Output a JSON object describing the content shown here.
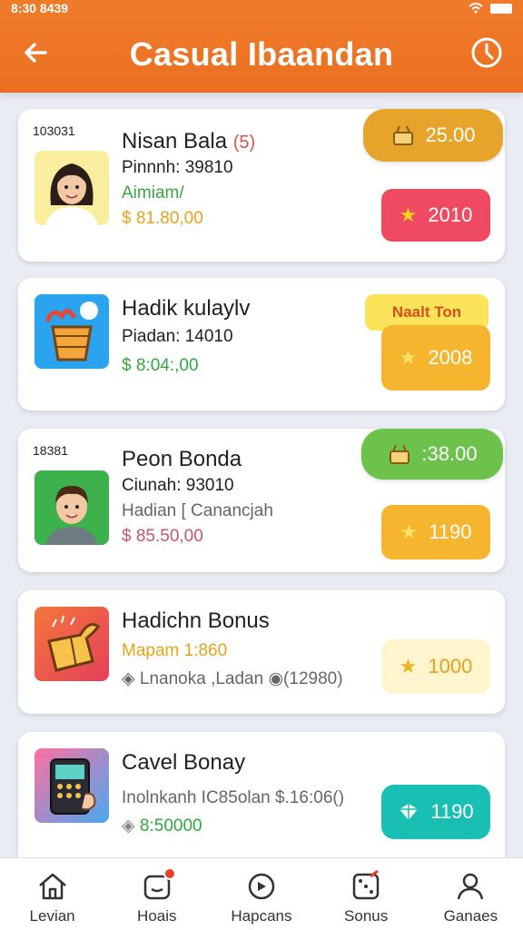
{
  "statusbar": {
    "time": "8:30  8439"
  },
  "header": {
    "title": "Casual Ibaandan"
  },
  "cards": [
    {
      "tag": "103031",
      "name": "Nisan Bala",
      "count": "(5)",
      "line1": "Pinnnh: 39810",
      "line2": "Aimiam/",
      "line3": "$ 81.80,00",
      "pill": "25.00",
      "button": "2010"
    },
    {
      "name": "Hadik kulaylv",
      "line1": "Piadan: 14010",
      "line2": "$ 8:04:,00",
      "ribbon": "Naalt Ton",
      "button": "2008"
    },
    {
      "tag": "18381",
      "name": "Peon Bonda",
      "line1": "Ciunah: 93010",
      "line2": "Hadian [ Canancjah",
      "line3": "$ 85.50,00",
      "pill": ":38.00",
      "button": "1190"
    },
    {
      "name": "Hadichn Bonus",
      "line1": "Mapam 1:860",
      "line2": "Lnanoka ,Ladan",
      "line2b": "(12980)",
      "button": "1000"
    },
    {
      "name": "Cavel Bonay",
      "line1": "Inolnkanh IC85olan  $.16:06()",
      "line2": "8:50000",
      "button": "1190"
    }
  ],
  "nav": [
    {
      "label": "Levian",
      "icon": "home-icon"
    },
    {
      "label": "Hoais",
      "icon": "notification-icon"
    },
    {
      "label": "Hapcans",
      "icon": "search-icon"
    },
    {
      "label": "Sonus",
      "icon": "dice-icon"
    },
    {
      "label": "Ganaes",
      "icon": "profile-icon"
    }
  ],
  "colors": {
    "header": "#ef7a2a",
    "gold_pill": "#e6a52a",
    "green_pill": "#6cc24a",
    "red_button": "#ef4a62",
    "orange_button": "#f5b52e",
    "cream_button": "#fff5cf",
    "teal_button": "#19bfb2"
  }
}
